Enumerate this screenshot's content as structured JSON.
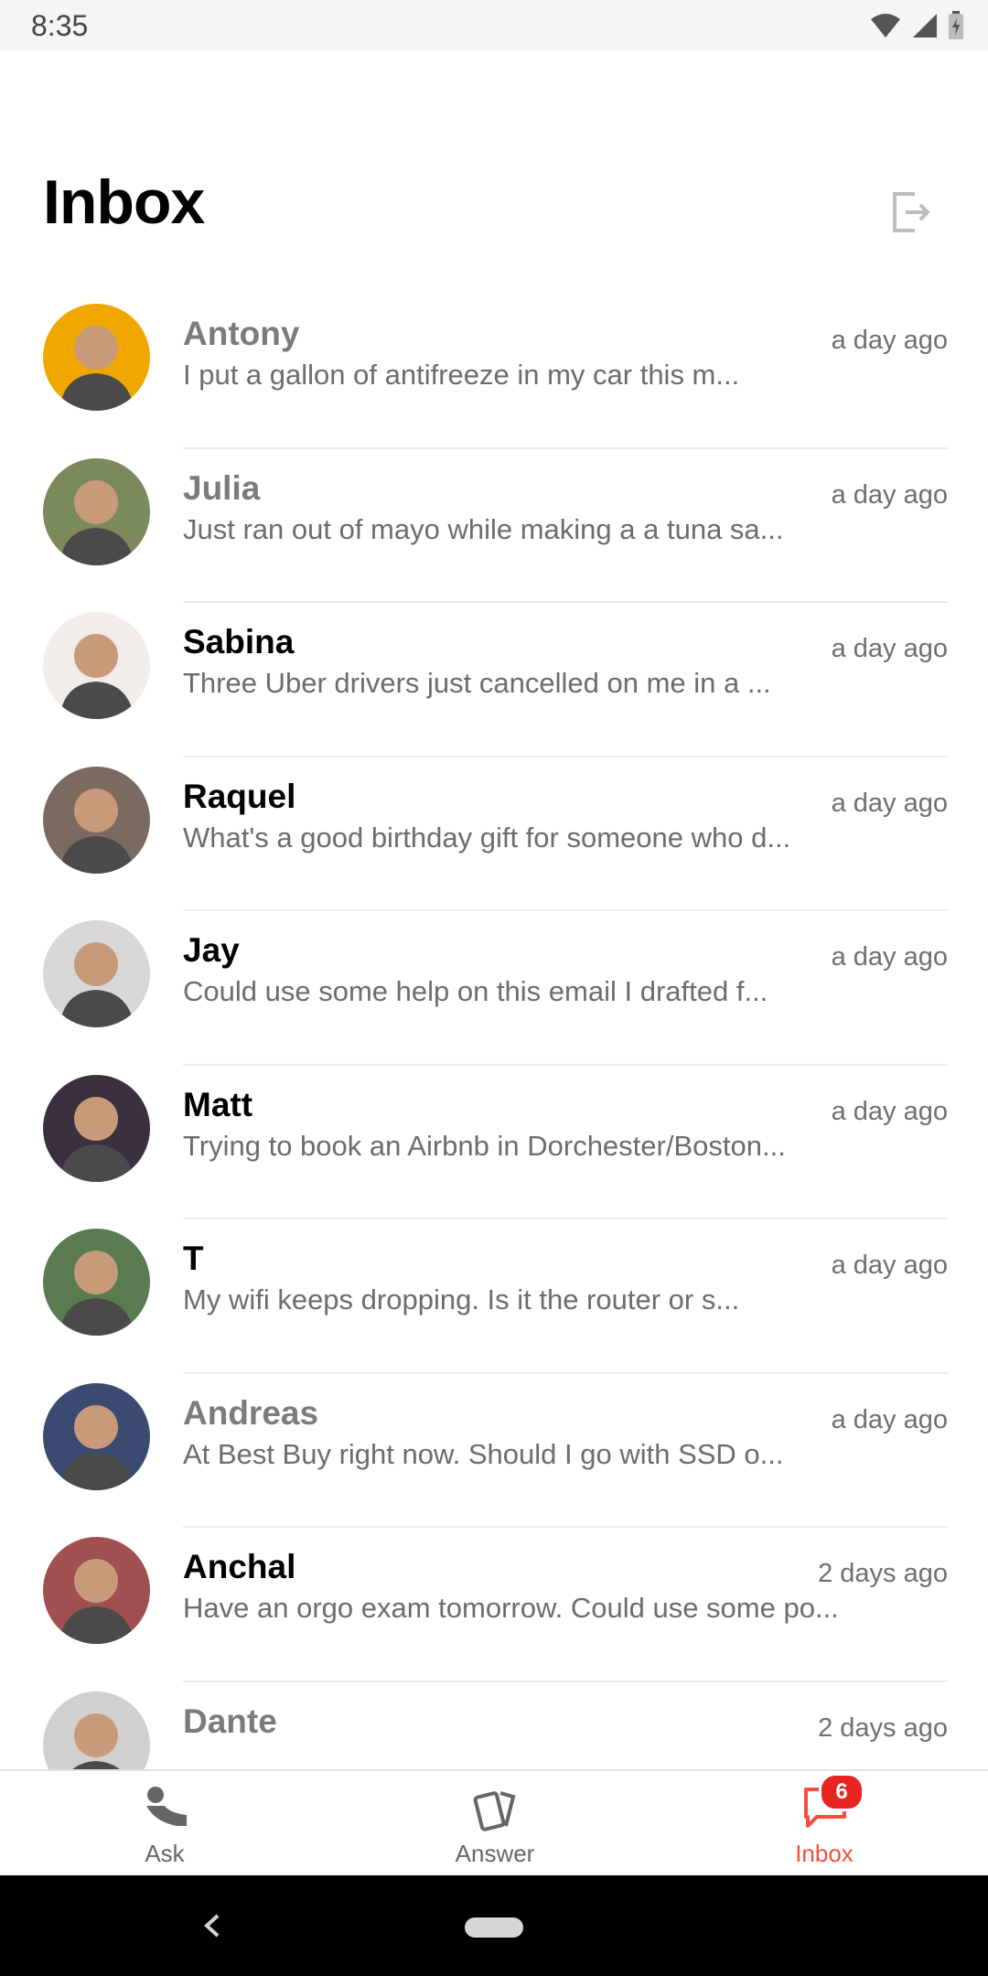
{
  "status_bar": {
    "time": "8:35"
  },
  "header": {
    "title": "Inbox"
  },
  "conversations": [
    {
      "name": "Antony",
      "time": "a day ago",
      "preview": "I put a gallon of antifreeze in my car this m...",
      "read": true,
      "avatar_color": "#f0a800"
    },
    {
      "name": "Julia",
      "time": "a day ago",
      "preview": "Just ran out of mayo while making a a tuna sa...",
      "read": true,
      "avatar_color": "#7a8a5a"
    },
    {
      "name": "Sabina",
      "time": "a day ago",
      "preview": "Three Uber drivers just cancelled on me in a ...",
      "read": false,
      "avatar_color": "#f2ede8"
    },
    {
      "name": "Raquel",
      "time": "a day ago",
      "preview": "What's a good birthday gift for someone who d...",
      "read": false,
      "avatar_color": "#7a6a60"
    },
    {
      "name": "Jay",
      "time": "a day ago",
      "preview": "Could use some help on this email I drafted f...",
      "read": false,
      "avatar_color": "#d8d8d8"
    },
    {
      "name": "Matt",
      "time": "a day ago",
      "preview": "Trying to book an Airbnb in Dorchester/Boston...",
      "read": false,
      "avatar_color": "#3a3040"
    },
    {
      "name": "T",
      "time": "a day ago",
      "preview": "My wifi keeps dropping. Is it the router or s...",
      "read": false,
      "avatar_color": "#5a7a50"
    },
    {
      "name": "Andreas",
      "time": "a day ago",
      "preview": "At Best Buy right now. Should I go with SSD o...",
      "read": true,
      "avatar_color": "#3a4a70"
    },
    {
      "name": "Anchal",
      "time": "2 days ago",
      "preview": "Have an orgo exam tomorrow. Could use some po...",
      "read": false,
      "avatar_color": "#a05050"
    },
    {
      "name": "Dante",
      "time": "2 days ago",
      "preview": "",
      "read": true,
      "avatar_color": "#d0d0d0"
    }
  ],
  "bottom_nav": {
    "items": [
      {
        "label": "Ask",
        "icon": "person-call-icon",
        "active": false
      },
      {
        "label": "Answer",
        "icon": "cards-icon",
        "active": false
      },
      {
        "label": "Inbox",
        "icon": "chat-bubble-icon",
        "active": true,
        "badge": "6"
      }
    ]
  },
  "colors": {
    "accent": "#f2503a",
    "badge": "#e8251f",
    "muted_name": "#7b7b7b"
  }
}
